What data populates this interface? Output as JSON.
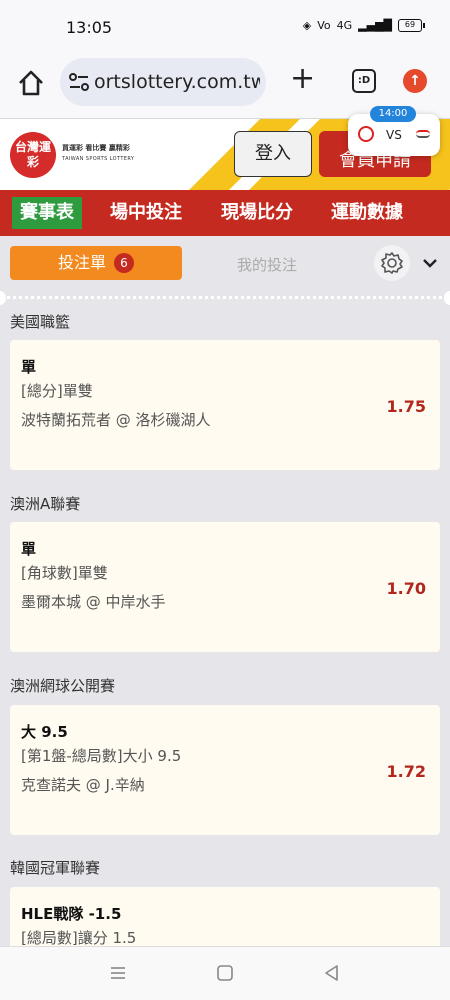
{
  "status": {
    "time": "13:05",
    "battery": "69",
    "network": "4G"
  },
  "browser": {
    "url": "ortslottery.com.tw",
    "tabs_label": ":D"
  },
  "header": {
    "logo_text": "台灣運彩",
    "logo_sub1": "買運彩 看比賽 贏精彩",
    "logo_sub2": "TAIWAN SPORTS LOTTERY",
    "login_label": "登入",
    "member_label": "會員申請",
    "live_time": "14:00",
    "live_vs": "VS"
  },
  "nav": {
    "items": [
      "賽事表",
      "場中投注",
      "現場比分",
      "運動數據"
    ]
  },
  "bet_tabs": {
    "slip_label": "投注單",
    "slip_count": "6",
    "mybets_label": "我的投注"
  },
  "bets": [
    {
      "league": "美國職籃",
      "selection": "單",
      "market": "[總分]單雙",
      "match": "波特蘭拓荒者 @ 洛杉磯湖人",
      "odds": "1.75"
    },
    {
      "league": "澳洲A聯賽",
      "selection": "單",
      "market": "[角球數]單雙",
      "match": "墨爾本城 @ 中岸水手",
      "odds": "1.70"
    },
    {
      "league": "澳洲網球公開賽",
      "selection": "大 9.5",
      "market": "[第1盤-總局數]大小 9.5",
      "match": "克查諾夫 @ J.辛納",
      "odds": "1.72"
    },
    {
      "league": "韓國冠軍聯賽",
      "selection": "HLE戰隊 -1.5",
      "market": "[總局數]讓分 1.5",
      "match": "",
      "odds": ""
    }
  ],
  "colors": {
    "primary_red": "#c42a1f",
    "accent_orange": "#f28a1f",
    "active_green": "#2e9b3e",
    "odds_red": "#b1271e"
  }
}
